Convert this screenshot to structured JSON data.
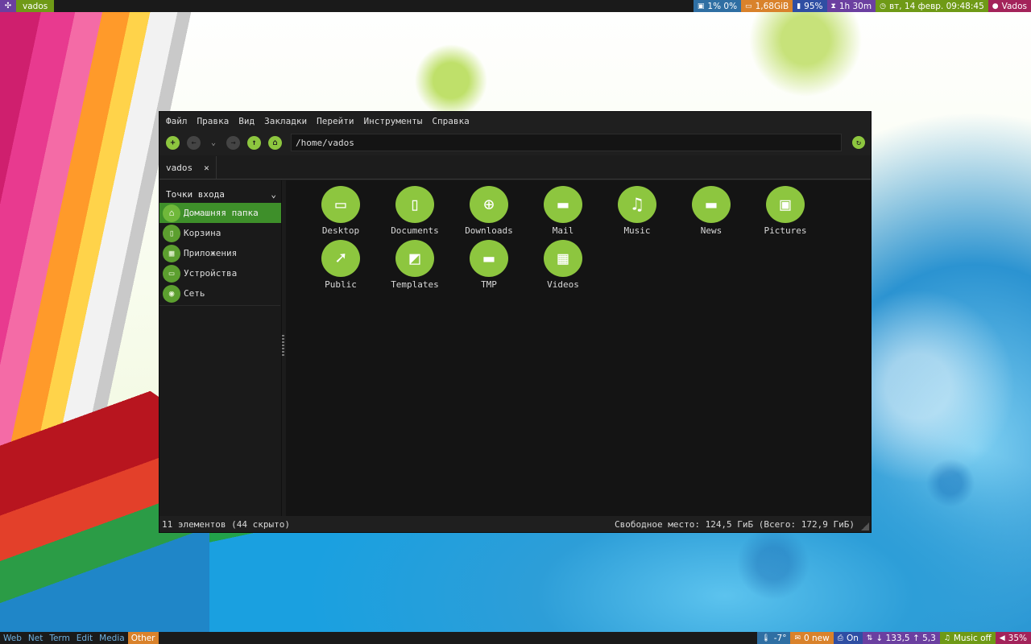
{
  "top_panel": {
    "workspace": "vados",
    "widgets": [
      {
        "icon": "cpu-icon",
        "text": "1% 0%",
        "color": "#2f6fa3"
      },
      {
        "icon": "memory-icon",
        "text": "1,68GiB",
        "color": "#d9822b"
      },
      {
        "icon": "battery-icon",
        "text": "95%",
        "color": "#2f4ea3"
      },
      {
        "icon": "hourglass-icon",
        "text": "1h 30m",
        "color": "#6b3fa0"
      },
      {
        "icon": "clock-icon",
        "text": "вт, 14 февр. 09:48:45",
        "color": "#6f9a16"
      },
      {
        "icon": "user-icon",
        "text": "Vados",
        "color": "#a3235a"
      }
    ]
  },
  "file_manager": {
    "menu": [
      "Файл",
      "Правка",
      "Вид",
      "Закладки",
      "Перейти",
      "Инструменты",
      "Справка"
    ],
    "path": "/home/vados",
    "tab_label": "vados",
    "sidebar": {
      "header": "Точки входа",
      "items": [
        {
          "label": "Домашняя папка",
          "icon": "home-icon",
          "selected": true
        },
        {
          "label": "Корзина",
          "icon": "trash-icon",
          "selected": false
        },
        {
          "label": "Приложения",
          "icon": "apps-icon",
          "selected": false
        },
        {
          "label": "Устройства",
          "icon": "monitor-icon",
          "selected": false
        },
        {
          "label": "Сеть",
          "icon": "network-icon",
          "selected": false
        }
      ]
    },
    "files": [
      {
        "name": "Desktop",
        "icon": "desktop-folder-icon"
      },
      {
        "name": "Documents",
        "icon": "documents-folder-icon"
      },
      {
        "name": "Downloads",
        "icon": "downloads-folder-icon"
      },
      {
        "name": "Mail",
        "icon": "folder-icon"
      },
      {
        "name": "Music",
        "icon": "music-folder-icon"
      },
      {
        "name": "News",
        "icon": "folder-icon"
      },
      {
        "name": "Pictures",
        "icon": "pictures-folder-icon"
      },
      {
        "name": "Public",
        "icon": "public-folder-icon"
      },
      {
        "name": "Templates",
        "icon": "templates-folder-icon"
      },
      {
        "name": "TMP",
        "icon": "folder-icon"
      },
      {
        "name": "Videos",
        "icon": "videos-folder-icon"
      }
    ],
    "status_left": "11 элементов (44 скрыто)",
    "status_right": "Свободное место: 124,5 ГиБ (Всего: 172,9 ГиБ)"
  },
  "bottom_panel": {
    "tags": [
      {
        "label": "Web",
        "active": false
      },
      {
        "label": "Net",
        "active": false
      },
      {
        "label": "Term",
        "active": false
      },
      {
        "label": "Edit",
        "active": false
      },
      {
        "label": "Media",
        "active": false
      },
      {
        "label": "Other",
        "active": true
      }
    ],
    "widgets": [
      {
        "icon": "thermometer-icon",
        "text": "-7°",
        "color": "#2f6fa3"
      },
      {
        "icon": "mail-icon",
        "text": "0 new",
        "color": "#d9822b"
      },
      {
        "icon": "printer-icon",
        "text": "On",
        "color": "#2f4ea3"
      },
      {
        "icon": "network-speed-icon",
        "text": "↓ 133,5 ↑ 5,3",
        "color": "#6b3fa0"
      },
      {
        "icon": "headphones-icon",
        "text": "Music off",
        "color": "#6f9a16"
      },
      {
        "icon": "volume-icon",
        "text": "35%",
        "color": "#a3235a"
      }
    ]
  }
}
